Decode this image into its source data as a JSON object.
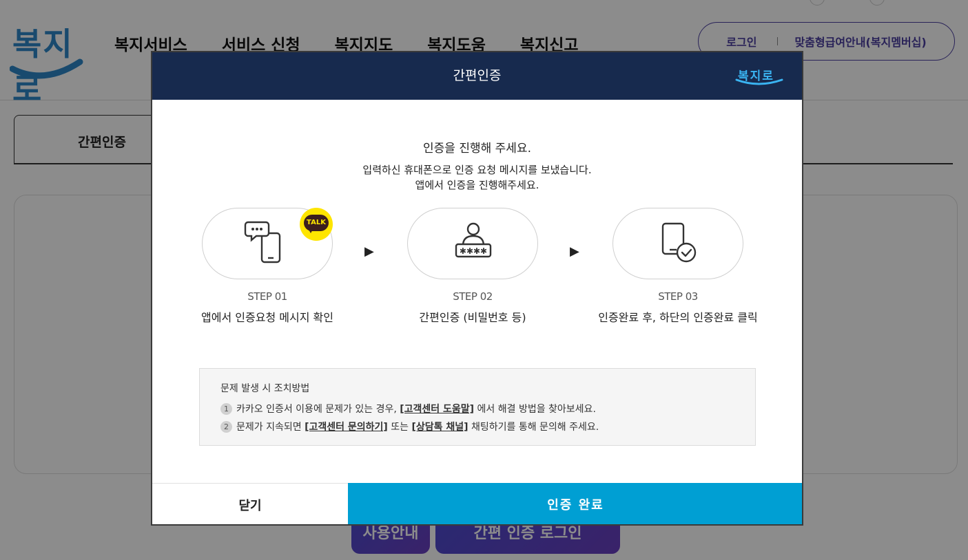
{
  "site": {
    "logo_text": "복지로",
    "nav": [
      "복지서비스",
      "서비스 신청",
      "복지지도",
      "복지도움",
      "복지신고"
    ],
    "login": "로그인",
    "membership": "맞춤형급여안내(복지멤버십)",
    "active_tab": "간편인증",
    "bg_buttons": [
      "사용안내",
      "간편 인증 로그인"
    ]
  },
  "modal": {
    "title": "간편인증",
    "logo_text": "복지로",
    "intro_main": "인증을 진행해 주세요.",
    "intro_sub1": "입력하신 휴대폰으로 인증 요청 메시지를 보냈습니다.",
    "intro_sub2": "앱에서 인증을 진행해주세요.",
    "talk_badge": "TALK",
    "arrow": "▶",
    "steps": [
      {
        "num": "STEP 01",
        "desc": "앱에서 인증요청 메시지 확인",
        "icon": "phone-chat-icon"
      },
      {
        "num": "STEP 02",
        "desc": "간편인증 (비밀번호 등)",
        "icon": "user-password-icon"
      },
      {
        "num": "STEP 03",
        "desc": "인증완료 후, 하단의 인증완료 클릭",
        "icon": "phone-check-icon"
      }
    ],
    "trouble": {
      "title": "문제 발생 시 조치방법",
      "item1": {
        "num": "1",
        "pre": "카카오 인증서 이용에 문제가 있는 경우, ",
        "link": "[고객센터 도움말]",
        "post": " 에서 해결 방법을 찾아보세요."
      },
      "item2": {
        "num": "2",
        "pre": "문제가 지속되면 ",
        "link1": "[고객센터 문의하기]",
        "mid": " 또는 ",
        "link2": "[상담톡 채널]",
        "post": " 채팅하기를 통해 문의해 주세요."
      }
    },
    "close_label": "닫기",
    "done_label": "인증 완료"
  },
  "colors": {
    "modal_header": "#172a4e",
    "done_button": "#009fd3",
    "kakao_yellow": "#fee500"
  }
}
